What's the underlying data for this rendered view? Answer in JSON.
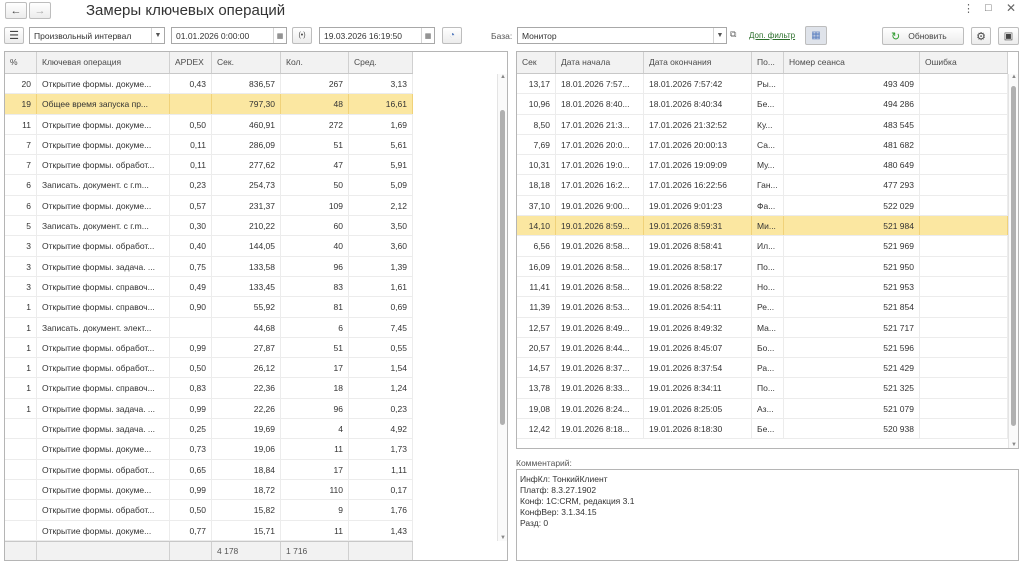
{
  "window": {
    "title": "Замеры ключевых операций"
  },
  "nav": {
    "back": "←",
    "forward": "→"
  },
  "toolbar": {
    "period_type": "Произвольный интервал",
    "date_from": "01.01.2026  0:00:00",
    "date_to": "19.03.2026 16:19:50",
    "base_label": "База:",
    "base_value": "Монитор",
    "filter_link": "Доп. фильтр",
    "refresh_label": "Обновить"
  },
  "left_table": {
    "columns": [
      "%",
      "Ключевая операция",
      "APDEX",
      "Сек.",
      "Кол.",
      "Сред."
    ],
    "rows": [
      [
        "20",
        "Открытие формы. докуме...",
        "0,43",
        "836,57",
        "267",
        "3,13"
      ],
      [
        "19",
        "Общее время запуска пр...",
        "",
        "797,30",
        "48",
        "16,61"
      ],
      [
        "11",
        "Открытие формы. докуме...",
        "0,50",
        "460,91",
        "272",
        "1,69"
      ],
      [
        "7",
        "Открытие формы. докуме...",
        "0,11",
        "286,09",
        "51",
        "5,61"
      ],
      [
        "7",
        "Открытие формы. обработ...",
        "0,11",
        "277,62",
        "47",
        "5,91"
      ],
      [
        "6",
        "Записать. документ. с г.m...",
        "0,23",
        "254,73",
        "50",
        "5,09"
      ],
      [
        "6",
        "Открытие формы. докуме...",
        "0,57",
        "231,37",
        "109",
        "2,12"
      ],
      [
        "5",
        "Записать. документ. с г.m...",
        "0,30",
        "210,22",
        "60",
        "3,50"
      ],
      [
        "3",
        "Открытие формы. обработ...",
        "0,40",
        "144,05",
        "40",
        "3,60"
      ],
      [
        "3",
        "Открытие формы. задача. ...",
        "0,75",
        "133,58",
        "96",
        "1,39"
      ],
      [
        "3",
        "Открытие формы. справоч...",
        "0,49",
        "133,45",
        "83",
        "1,61"
      ],
      [
        "1",
        "Открытие формы. справоч...",
        "0,90",
        "55,92",
        "81",
        "0,69"
      ],
      [
        "1",
        "Записать. документ. элект...",
        "",
        "44,68",
        "6",
        "7,45"
      ],
      [
        "1",
        "Открытие формы. обработ...",
        "0,99",
        "27,87",
        "51",
        "0,55"
      ],
      [
        "1",
        "Открытие формы. обработ...",
        "0,50",
        "26,12",
        "17",
        "1,54"
      ],
      [
        "1",
        "Открытие формы. справоч...",
        "0,83",
        "22,36",
        "18",
        "1,24"
      ],
      [
        "1",
        "Открытие формы. задача. ...",
        "0,99",
        "22,26",
        "96",
        "0,23"
      ],
      [
        "",
        "Открытие формы. задача. ...",
        "0,25",
        "19,69",
        "4",
        "4,92"
      ],
      [
        "",
        "Открытие формы. докуме...",
        "0,73",
        "19,06",
        "11",
        "1,73"
      ],
      [
        "",
        "Открытие формы. обработ...",
        "0,65",
        "18,84",
        "17",
        "1,11"
      ],
      [
        "",
        "Открытие формы. докуме...",
        "0,99",
        "18,72",
        "110",
        "0,17"
      ],
      [
        "",
        "Открытие формы. обработ...",
        "0,50",
        "15,82",
        "9",
        "1,76"
      ],
      [
        "",
        "Открытие формы. докуме...",
        "0,77",
        "15,71",
        "11",
        "1,43"
      ]
    ],
    "totals": {
      "sec": "4 178",
      "count": "1 716"
    }
  },
  "right_table": {
    "columns": [
      "Сек",
      "Дата начала",
      "Дата окончания",
      "По...",
      "Номер сеанса",
      "Ошибка"
    ],
    "rows": [
      [
        "13,17",
        "18.01.2026 7:57...",
        "18.01.2026 7:57:42",
        "Ры...",
        "493 409",
        ""
      ],
      [
        "10,96",
        "18.01.2026 8:40...",
        "18.01.2026 8:40:34",
        "Бе...",
        "494 286",
        ""
      ],
      [
        "8,50",
        "17.01.2026 21:3...",
        "17.01.2026 21:32:52",
        "Ку...",
        "483 545",
        ""
      ],
      [
        "7,69",
        "17.01.2026 20:0...",
        "17.01.2026 20:00:13",
        "Са...",
        "481 682",
        ""
      ],
      [
        "10,31",
        "17.01.2026 19:0...",
        "17.01.2026 19:09:09",
        "Му...",
        "480 649",
        ""
      ],
      [
        "18,18",
        "17.01.2026 16:2...",
        "17.01.2026 16:22:56",
        "Ган...",
        "477 293",
        ""
      ],
      [
        "37,10",
        "19.01.2026 9:00...",
        "19.01.2026 9:01:23",
        "Фа...",
        "522 029",
        ""
      ],
      [
        "14,10",
        "19.01.2026 8:59...",
        "19.01.2026 8:59:31",
        "Ми...",
        "521 984",
        ""
      ],
      [
        "6,56",
        "19.01.2026 8:58...",
        "19.01.2026 8:58:41",
        "Ил...",
        "521 969",
        ""
      ],
      [
        "16,09",
        "19.01.2026 8:58...",
        "19.01.2026 8:58:17",
        "По...",
        "521 950",
        ""
      ],
      [
        "11,41",
        "19.01.2026 8:58...",
        "19.01.2026 8:58:22",
        "Но...",
        "521 953",
        ""
      ],
      [
        "11,39",
        "19.01.2026 8:53...",
        "19.01.2026 8:54:11",
        "Ре...",
        "521 854",
        ""
      ],
      [
        "12,57",
        "19.01.2026 8:49...",
        "19.01.2026 8:49:32",
        "Ма...",
        "521 717",
        ""
      ],
      [
        "20,57",
        "19.01.2026 8:44...",
        "19.01.2026 8:45:07",
        "Бо...",
        "521 596",
        ""
      ],
      [
        "14,57",
        "19.01.2026 8:37...",
        "19.01.2026 8:37:54",
        "Ра...",
        "521 429",
        ""
      ],
      [
        "13,78",
        "19.01.2026 8:33...",
        "19.01.2026 8:34:11",
        "По...",
        "521 325",
        ""
      ],
      [
        "19,08",
        "19.01.2026 8:24...",
        "19.01.2026 8:25:05",
        "Аз...",
        "521 079",
        ""
      ],
      [
        "12,42",
        "19.01.2026 8:18...",
        "19.01.2026 8:18:30",
        "Бе...",
        "520 938",
        ""
      ]
    ]
  },
  "comment": {
    "label": "Комментарий:",
    "lines": [
      "ИнфКл: ТонкийКлиент",
      "Платф: 8.3.27.1902",
      "Конф: 1С:CRM, редакция 3.1",
      "КонфВер: 3.1.34.15",
      "Разд: 0"
    ]
  },
  "colors": {
    "selection": "#fbe7a1",
    "link": "#2a6e2a",
    "refresh_icon": "#2e9b2e"
  }
}
